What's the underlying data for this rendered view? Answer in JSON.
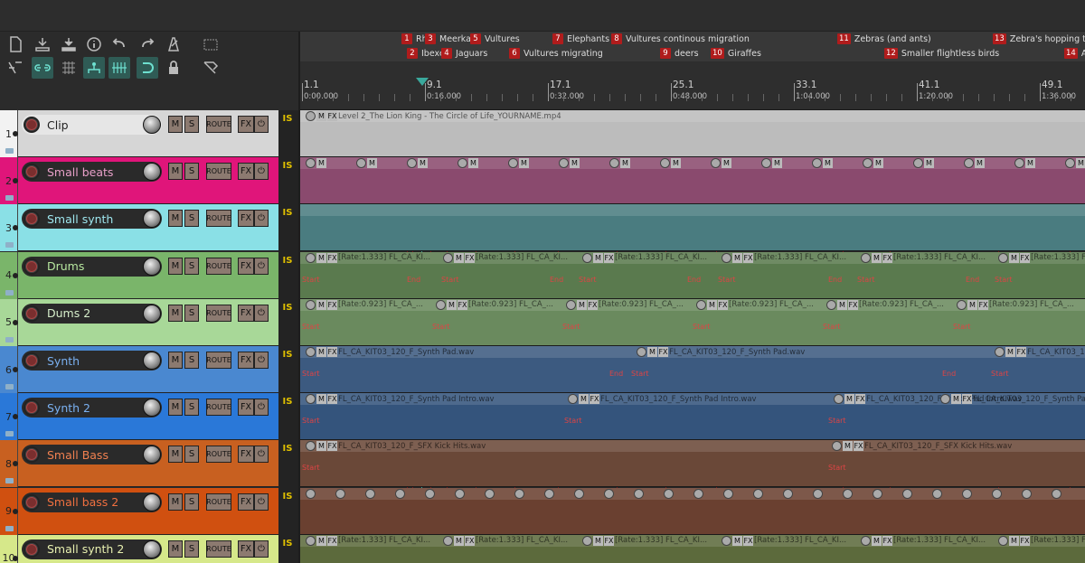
{
  "colors": {
    "accent": "#3aa89c",
    "marker": "#b01c1c",
    "is": "#e0c000"
  },
  "toolbar": {
    "icons": [
      "new-file-icon",
      "save-icon",
      "save-as-icon",
      "info-icon",
      "undo-icon",
      "redo-icon",
      "metronome-icon",
      "grid-icon",
      "ripple-icon",
      "link-icon",
      "snap-grid-icon",
      "group-icon",
      "auto-crossfade-icon",
      "loop-icon",
      "lock-icon",
      "envelope-icon"
    ]
  },
  "markers": [
    {
      "n": "1",
      "label": "Rhi",
      "row": 0
    },
    {
      "n": "2",
      "label": "Ibexe",
      "row": 1
    },
    {
      "n": "3",
      "label": "Meerkat",
      "row": 0
    },
    {
      "n": "4",
      "label": "Jaguars",
      "row": 1
    },
    {
      "n": "5",
      "label": "Vultures",
      "row": 0
    },
    {
      "n": "6",
      "label": "Vultures migrating",
      "row": 1
    },
    {
      "n": "7",
      "label": "Elephants",
      "row": 0
    },
    {
      "n": "8",
      "label": "Vultures continous migration",
      "row": 0
    },
    {
      "n": "9",
      "label": "deers",
      "row": 1
    },
    {
      "n": "10",
      "label": "Giraffes",
      "row": 1
    },
    {
      "n": "11",
      "label": "Zebras (and ants)",
      "row": 0
    },
    {
      "n": "12",
      "label": "Smaller flightless birds",
      "row": 1
    },
    {
      "n": "13",
      "label": "Zebra's hopping thro",
      "row": 0
    },
    {
      "n": "14",
      "label": "A",
      "row": 1
    }
  ],
  "ruler": [
    {
      "bar": "1.1",
      "time": "0:00.000"
    },
    {
      "bar": "9.1",
      "time": "0:16.000"
    },
    {
      "bar": "17.1",
      "time": "0:32.000"
    },
    {
      "bar": "25.1",
      "time": "0:48.000"
    },
    {
      "bar": "33.1",
      "time": "1:04.000"
    },
    {
      "bar": "41.1",
      "time": "1:20.000"
    },
    {
      "bar": "49.1",
      "time": "1:36.000"
    }
  ],
  "tracks": [
    {
      "num": "1",
      "name": "Clip",
      "color": "#d6d6d6",
      "lane": "#bcbcbc",
      "nameColor": "#222",
      "nameBg": "#e6e6e6"
    },
    {
      "num": "2",
      "name": "Small beats",
      "color": "#e0157a",
      "lane": "#8a4a6e",
      "nameColor": "#e8a0c8"
    },
    {
      "num": "3",
      "name": "Small synth",
      "color": "#8ae0e6",
      "lane": "#4a7c80",
      "nameColor": "#9ee6ee"
    },
    {
      "num": "4",
      "name": "Drums",
      "color": "#7ab56a",
      "lane": "#5a7a4e",
      "nameColor": "#b8e8a0"
    },
    {
      "num": "5",
      "name": "Dums 2",
      "color": "#a8d898",
      "lane": "#6a8a5e",
      "nameColor": "#d8f0cc"
    },
    {
      "num": "6",
      "name": "Synth",
      "color": "#4a88d0",
      "lane": "#3c5a80",
      "nameColor": "#7ab0f0"
    },
    {
      "num": "7",
      "name": "Synth 2",
      "color": "#2a78d8",
      "lane": "#34547c",
      "nameColor": "#7ab0f0"
    },
    {
      "num": "8",
      "name": "Small Bass",
      "color": "#c86020",
      "lane": "#6a4838",
      "nameColor": "#f08050"
    },
    {
      "num": "9",
      "name": "Small bass 2",
      "color": "#d05010",
      "lane": "#6a4030",
      "nameColor": "#f07040"
    },
    {
      "num": "10",
      "name": "Small synth 2",
      "color": "#d6e88a",
      "lane": "#5c6a3c",
      "nameColor": "#e8f0b0"
    }
  ],
  "buttons": {
    "mute": "M",
    "solo": "S",
    "route": "ROUTE",
    "fx": "FX",
    "power": "⏻",
    "is": "IS"
  },
  "items": {
    "clip": "Level 2_The Lion King - The Circle of Life_YOURNAME.mp4",
    "drums": "[Rate:1.333] FL_CA_KI...",
    "dums2": "[Rate:0.923] FL_CA_...",
    "synthpad": "FL_CA_KIT03_120_F_Synth Pad.wav",
    "synthpadintro": "FL_CA_KIT03_120_F_Synth Pad Intro.wav",
    "kick": "FL_CA_KIT03_120_F_SFX Kick Hits.wav",
    "start": "Start",
    "end": "End"
  }
}
